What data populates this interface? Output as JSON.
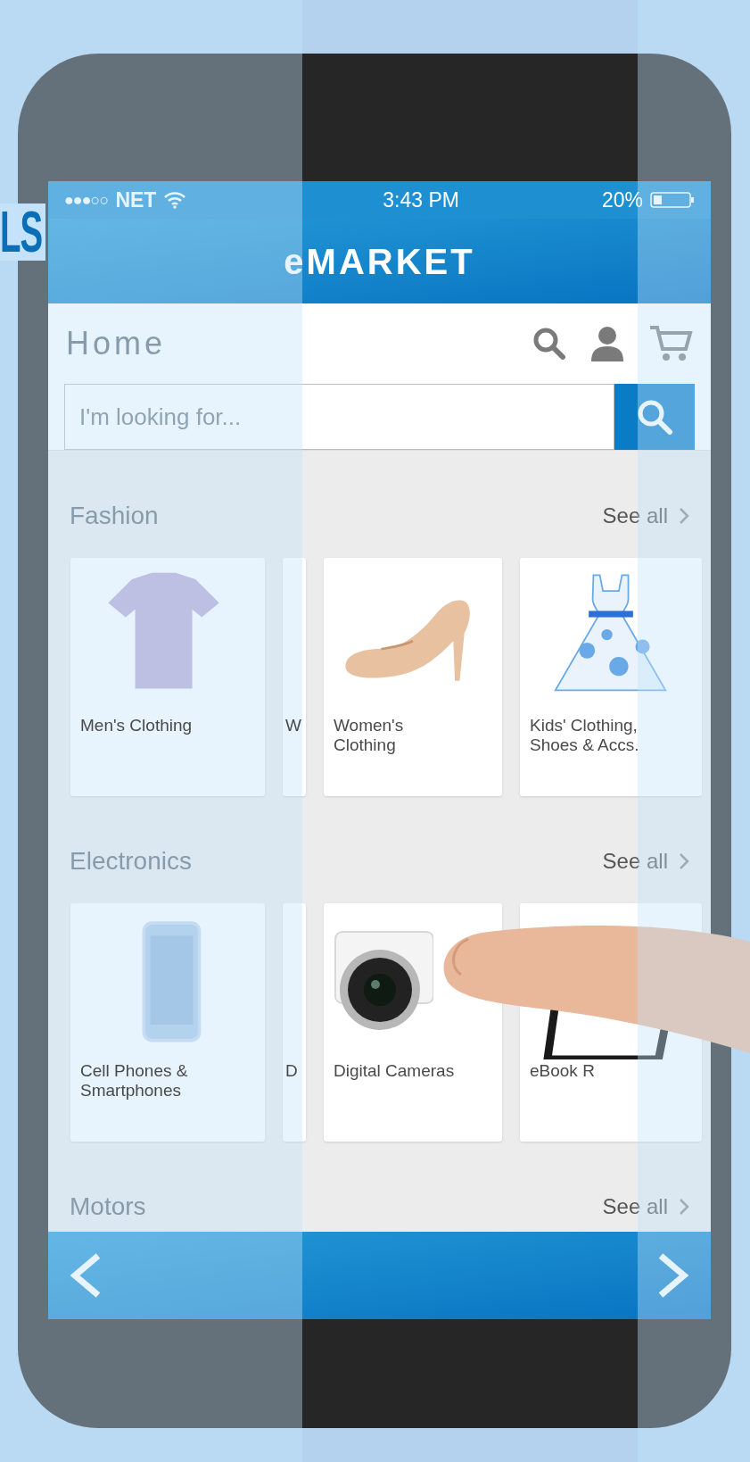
{
  "corner_text": "LS",
  "status_bar": {
    "signal": "●●●○○",
    "carrier": "NET",
    "time": "3:43 PM",
    "battery": "20%"
  },
  "header": {
    "title": "eMARKET"
  },
  "page_title": "Home",
  "search": {
    "placeholder": "I'm looking for..."
  },
  "sections": [
    {
      "title": "Fashion",
      "see_all": "See all",
      "cards": [
        {
          "label": "Men's Clothing",
          "kind": "tshirt"
        },
        {
          "label": "W",
          "kind": "ghost"
        },
        {
          "label": "Women's Clothing",
          "kind": "shoe"
        },
        {
          "label": "Kids' Clothing, Shoes & Accs.",
          "kind": "dress"
        }
      ]
    },
    {
      "title": "Electronics",
      "see_all": "See all",
      "cards": [
        {
          "label": "Cell Phones & Smartphones",
          "kind": "phone"
        },
        {
          "label": "D",
          "kind": "ghost"
        },
        {
          "label": "Digital Cameras",
          "kind": "camera"
        },
        {
          "label": "eBook R",
          "kind": "tablet"
        }
      ]
    },
    {
      "title": "Motors",
      "see_all": "See all"
    }
  ]
}
